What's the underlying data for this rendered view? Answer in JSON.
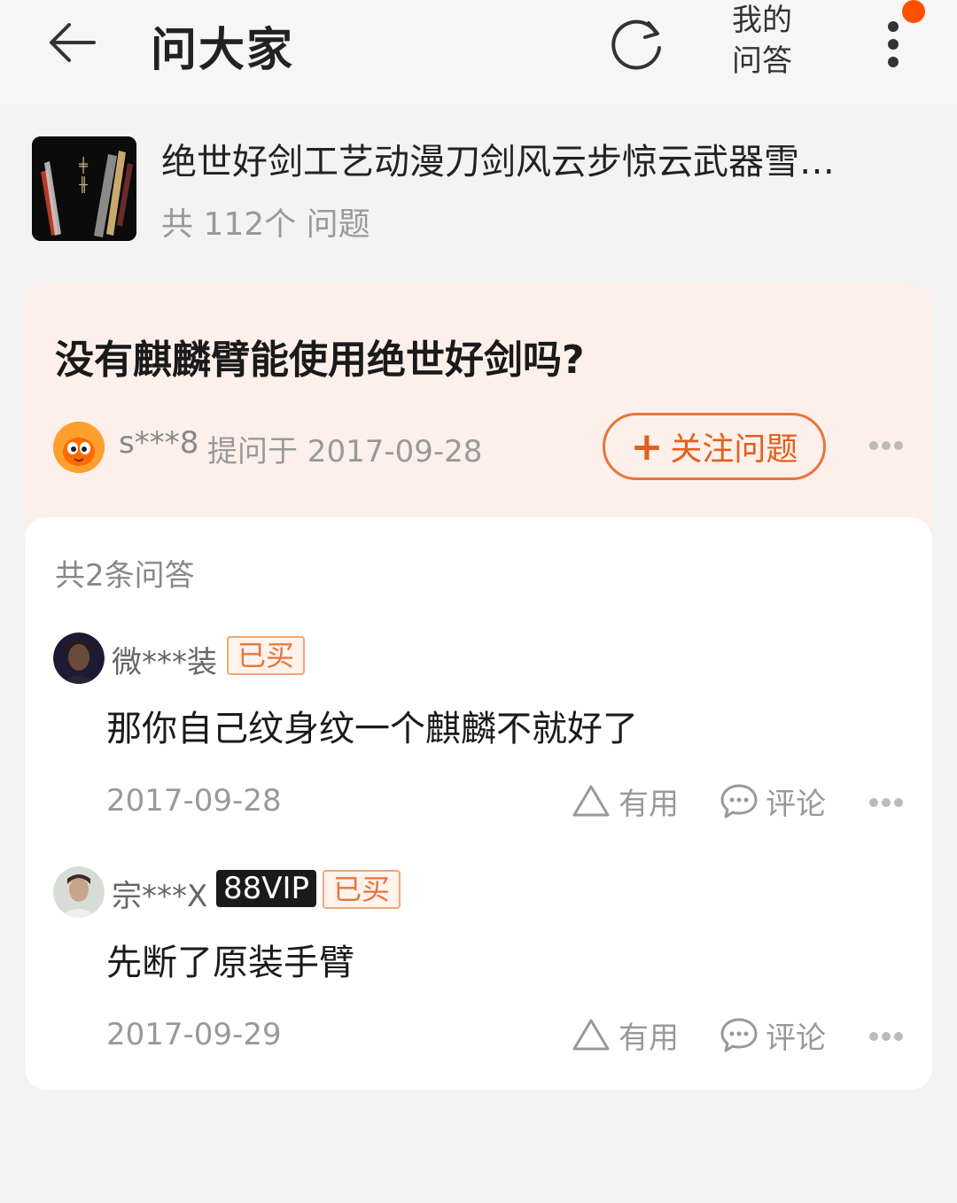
{
  "header": {
    "title": "问大家",
    "my_qa_line1": "我的",
    "my_qa_line2": "问答"
  },
  "product": {
    "title": "绝世好剑工艺动漫刀剑风云步惊云武器雪…",
    "question_count": "共 112个 问题"
  },
  "question": {
    "text": "没有麒麟臂能使用绝世好剑吗?",
    "asker": "s***8",
    "asked_at": "提问于 2017-09-28",
    "follow_label": "关注问题"
  },
  "answers": {
    "count_label": "共2条问答",
    "items": [
      {
        "user": "微***装",
        "badges": [
          "已买"
        ],
        "text": "那你自己纹身纹一个麒麟不就好了",
        "date": "2017-09-28",
        "useful_label": "有用",
        "comment_label": "评论"
      },
      {
        "user": "宗***X",
        "vip": "88VIP",
        "badges": [
          "已买"
        ],
        "text": "先断了原装手臂",
        "date": "2017-09-29",
        "useful_label": "有用",
        "comment_label": "评论"
      }
    ]
  },
  "colors": {
    "accent": "#e8743b",
    "notification": "#ff5000",
    "question_bg": "#fdf0eb"
  },
  "icons": {
    "back": "arrow-left-icon",
    "refresh": "refresh-icon",
    "more": "more-vertical-icon",
    "useful": "triangle-up-icon",
    "comment": "chat-bubble-icon"
  }
}
